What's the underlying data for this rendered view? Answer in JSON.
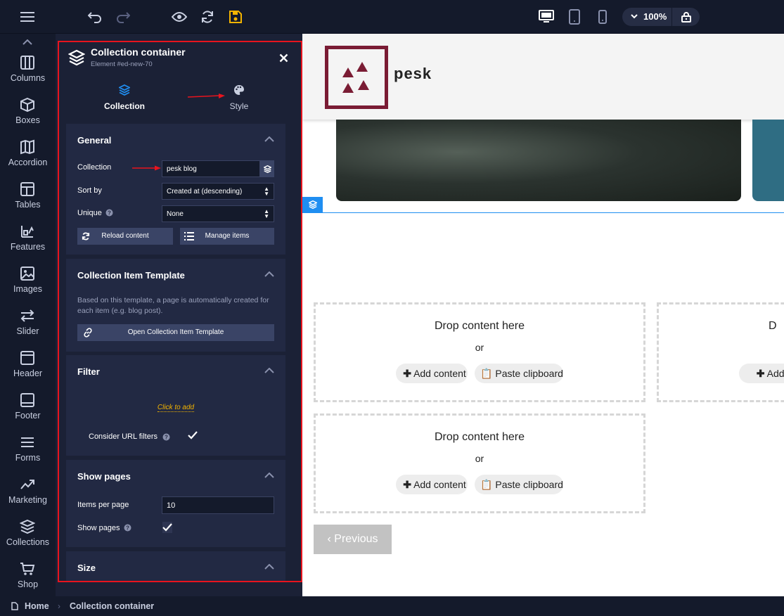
{
  "topbar": {
    "icons": [
      "menu-icon",
      "undo-icon",
      "redo-icon",
      "preview-icon",
      "refresh-icon",
      "save-icon",
      "desktop-icon",
      "tablet-icon",
      "mobile-icon",
      "lock-icon"
    ],
    "zoom": "100%"
  },
  "leftbar": {
    "items": [
      {
        "label": "Columns",
        "icon": "columns-icon"
      },
      {
        "label": "Boxes",
        "icon": "box-icon"
      },
      {
        "label": "Accordion",
        "icon": "accordion-icon"
      },
      {
        "label": "Tables",
        "icon": "table-icon"
      },
      {
        "label": "Features",
        "icon": "features-icon"
      },
      {
        "label": "Images",
        "icon": "image-icon"
      },
      {
        "label": "Slider",
        "icon": "slider-icon"
      },
      {
        "label": "Header",
        "icon": "header-icon"
      },
      {
        "label": "Footer",
        "icon": "footer-icon"
      },
      {
        "label": "Forms",
        "icon": "forms-icon"
      },
      {
        "label": "Marketing",
        "icon": "marketing-icon"
      },
      {
        "label": "Collections",
        "icon": "collections-icon"
      },
      {
        "label": "Shop",
        "icon": "cart-icon"
      }
    ]
  },
  "panel": {
    "title": "Collection container",
    "subtitle": "Element #ed-new-70",
    "tabs": [
      {
        "label": "Collection"
      },
      {
        "label": "Style"
      }
    ],
    "general": {
      "title": "General",
      "collection_label": "Collection",
      "collection_value": "pesk blog",
      "sort_label": "Sort by",
      "sort_value": "Created at (descending)",
      "unique_label": "Unique",
      "unique_value": "None",
      "reload_label": "Reload content",
      "manage_label": "Manage items"
    },
    "template": {
      "title": "Collection Item Template",
      "description": "Based on this template, a page is automatically created for each item (e.g. blog post).",
      "open_label": "Open Collection Item Template"
    },
    "filter": {
      "title": "Filter",
      "click_to_add": "Click to add",
      "url_filters_label": "Consider URL filters"
    },
    "show_pages": {
      "title": "Show pages",
      "items_label": "Items per page",
      "items_value": "10",
      "show_label": "Show pages"
    },
    "size": {
      "title": "Size"
    }
  },
  "canvas": {
    "logo_text": "pesk",
    "drop_text": "Drop content here",
    "or_text": "or",
    "add_content": "Add content",
    "paste_clipboard": "Paste clipboard",
    "drop_text_cut": "D",
    "add_content_cut": "Add co",
    "previous": "Previous"
  },
  "breadcrumb": {
    "home": "Home",
    "current": "Collection container"
  },
  "colors": {
    "accent": "#1f8ef1",
    "highlight": "#e8141e",
    "save": "#f4b400",
    "panel": "#1b2136",
    "section": "#222943"
  }
}
